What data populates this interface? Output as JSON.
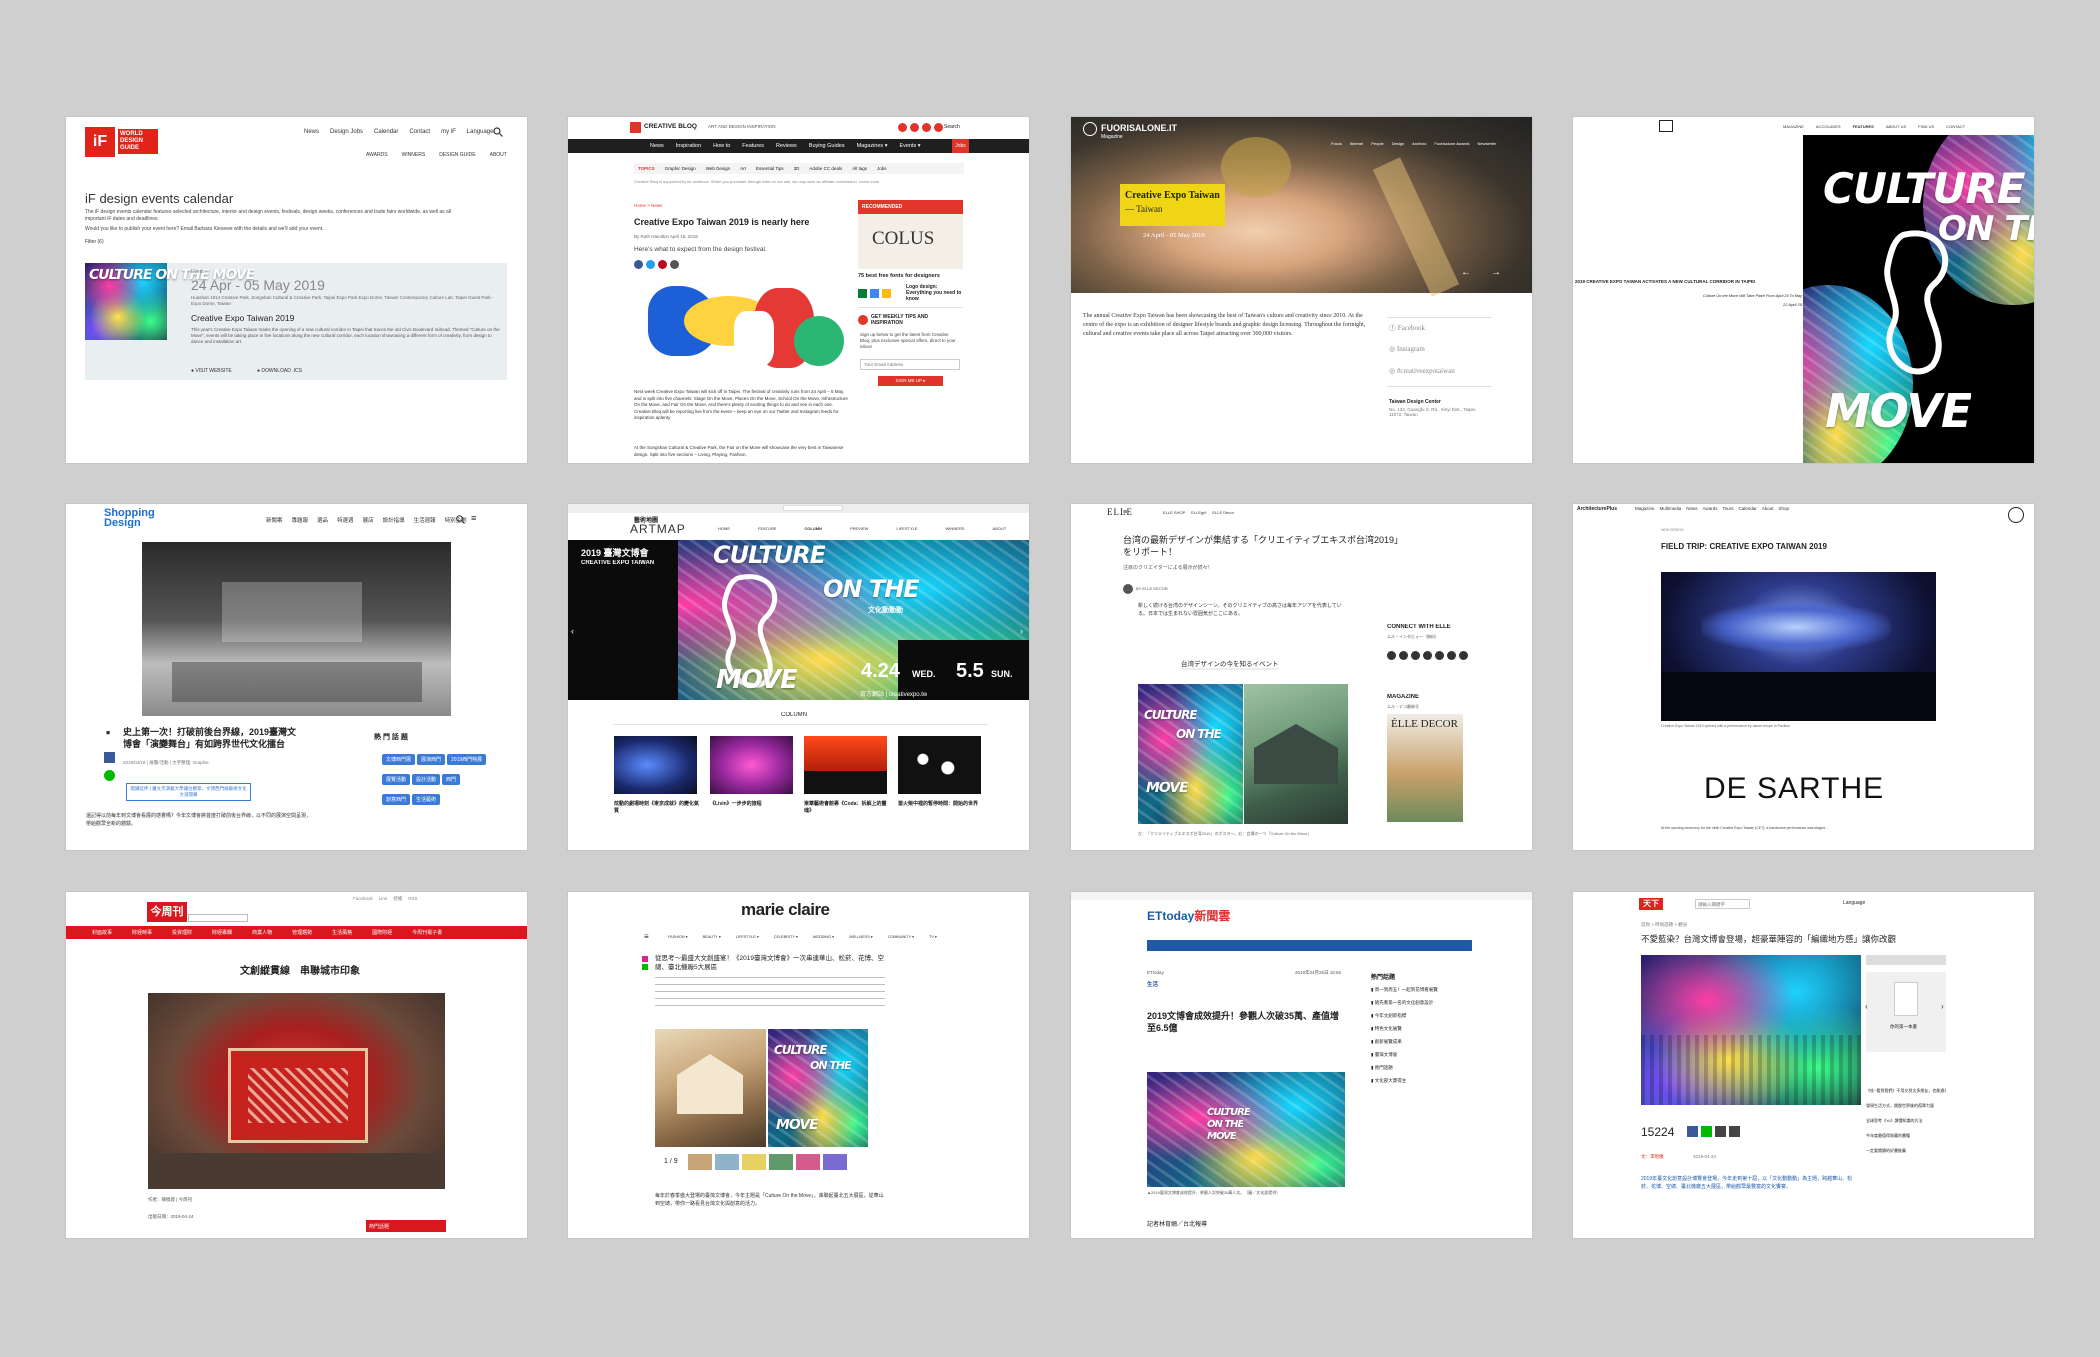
{
  "if": {
    "logo": "iF",
    "logo_sub": "WORLD DESIGN GUIDE",
    "nav": [
      "News",
      "Design Jobs",
      "Calendar",
      "Contact",
      "my iF",
      "Language"
    ],
    "subnav": [
      "AWARDS",
      "WINNERS",
      "DESIGN GUIDE",
      "ABOUT"
    ],
    "title": "iF design events calendar",
    "intro": "The iF design events calendar features selected architecture, interior and design events, festivals, design weeks, conferences and trade fairs worldwide, as well as all important iF dates and deadlines.",
    "intro2": "Would you like to publish your event here? Email Barbara Kiesewe with the details and we'll add your event.",
    "filter": "Filter (6)",
    "event_label": "Event",
    "date": "24 Apr - 05 May 2019",
    "location": "Huashan 1914 Creative Park, Songshan Cultural & Creative Park, Taipei Expo Park Expo Dome, Taiwan Contemporary Culture Lab, Taipei Guest Park - Expo Dome, Taiwan",
    "event_title": "Creative Expo Taiwan 2019",
    "desc": "This year's Creative Expo Taiwan marks the opening of a new cultural corridor in Taipei that traces the old Civic Boulevard railroad. Themed \"Culture on the Move\", events will be taking place in five locations along the new cultural corridor, each location showcasing a different form of creativity, from design to dance and installation art.",
    "visit": "VISIT WEBSITE",
    "download": "DOWNLOAD .ICS",
    "poster_text": "CULTURE ON THE MOVE"
  },
  "cb": {
    "logo": "CREATIVE BLOQ",
    "tagline": "ART AND DESIGN INSPIRATION",
    "search": "Search",
    "nav": [
      "News",
      "Inspiration",
      "How to",
      "Features",
      "Reviews",
      "Buying Guides",
      "Magazines ▾",
      "Events ▾"
    ],
    "jobs": "Jobs",
    "topics_label": "TOPICS",
    "topics": [
      "Graphic Design",
      "Web Design",
      "Art",
      "Essential Tips",
      "3D",
      "Adobe CC deals",
      "All tags",
      "Jobs"
    ],
    "disclaimer": "Creative Bloq is supported by its audience. When you purchase through links on our site, we may earn an affiliate commission. Learn more",
    "breadcrumb": "Home > News",
    "headline": "Creative Expo Taiwan 2019 is nearly here",
    "byline": "By Ruth Hamilton  April 15, 2019",
    "standfirst": "Here's what to expect from the design festival.",
    "recommended": "RECOMMENDED",
    "ad_brand": "COLUS",
    "ad_cap": "75 best free fonts for designers",
    "logo_design": "Logo design: Everything you need to know",
    "tips": "GET WEEKLY TIPS AND INSPIRATION",
    "signup": "Sign up below to get the latest from Creative Bloq, plus exclusive special offers, direct to your inbox!",
    "email_ph": "Your Email Address",
    "signup_btn": "SIGN ME UP ▸",
    "body1": "Next week Creative Expo Taiwan will kick off in Taipei. The festival of creativity runs from 24 April – 5 May, and is split into five channels: Stage On the Move, Places On the Move, School On the Move, Infrastructure On the Move, and Fair On the Move. And there's plenty of exciting things to do and see in each one. Creative Bloq will be reporting live from the event – keep an eye on our Twitter and Instagram feeds for inspiration aplenty.",
    "body2": "At the Songshan Cultural & Creative Park, the Fair on the Move will showcase the very best in Taiwanese design. Split into five sections – Living, Playing, Fashion,"
  },
  "fs": {
    "logo": "FUORISALONE.IT",
    "sub": "Magazine",
    "nav": [
      "Focus",
      "Itinerari",
      "People",
      "Design",
      "Archivio",
      "Fuorisalone Awards",
      "Newsletter"
    ],
    "hero_title": "Creative Expo Taiwan",
    "hero_sub": "— Taiwan",
    "hero_date": "24 April - 05 May 2019",
    "body": "The annual Creative Expo Taiwan has been showcasing the best of Taiwan's culture and creativity since 2010. At the centre of the expo is an exhibition of designer lifestyle brands and graphic design licensing. Throughout the fortnight, cultural and creative events take place all across Taipei attracting over 300,000 visitors.",
    "social": [
      "Facebook",
      "Instagram",
      "#creativeexpotaiwan"
    ],
    "org": "Taiwan Design Center",
    "addr": "No. 133, Guangfu S. Rd., Xinyi Dist., Taipei, 11072, Taiwan"
  },
  "af": {
    "nav": [
      "MAGAZINE",
      "ACCOLADES",
      "FEATURES",
      "ABOUT US",
      "FIND US",
      "CONTACT"
    ],
    "headline": "2019 CREATIVE EXPO TAIWAN ACTIVATES A NEW CULTURAL CORRIDOR IN TAIPEI",
    "caption": "Culture On the Move Will Take Place From April 24 To May 5",
    "date": "22 April 2019",
    "poster_top": "CULTURE",
    "poster_mid": "ON THE",
    "poster_bot": "MOVE"
  },
  "sd": {
    "logo_top": "Shopping",
    "logo_bot": "Design",
    "nav": [
      "新聞案",
      "專題報",
      "選品",
      "特選週",
      "展店",
      "設計指導",
      "生活週報",
      "特別企劃"
    ],
    "title": "史上第一次！打破前後台界線，2019臺灣文博會「演變舞台」有如跨界世代文化擂台",
    "meta": "2019/04/18 | 展覽/活動 | 文字整理: Graphie",
    "hot": "熱 門 話 題",
    "tags": [
      "文博西門展",
      "展演西門",
      "2019西門特展",
      "展覽活動",
      "設計活動",
      "西門",
      "創意西門",
      "生活藝術"
    ],
    "link_box": "閱讀延伸 | 蕭文杰演藝大學讓位觀眾，文博西門展藝術文化大道開幕",
    "body": "還記得以前每年到文博會看展的感覺嗎？今年文博會將首度打破前後台界線，以不同的展演空間呈現，帶給觀眾全新的體驗。"
  },
  "am": {
    "logo_cn": "藝術地圖",
    "logo": "ARTMAP",
    "nav": [
      "HOME",
      "FEATURE",
      "COLUMN",
      "PREVIEW",
      "LIFESTYLE",
      "WINNERS",
      "ABOUT"
    ],
    "banner_title": "2019 臺灣文博會",
    "banner_en": "CREATIVE EXPO TAIWAN",
    "cotm1": "CULTURE",
    "cotm2": "ON THE",
    "cotm3": "MOVE",
    "cn_sub": "文化動動動",
    "dates": "4.24",
    "wed": "WED.",
    "dates2": "5.5",
    "sun": "SUN.",
    "site": "官方網站 | creativexpo.tw",
    "section": "COLUMN",
    "thumbs": [
      "炫動的劇場時刻《東京成就》的變化氣質",
      "《Livin》一步步的旅程",
      "東華藝術會館專《Coda：拆解上的靈魂》",
      "當火柴中裡的暫停時間：開始的世界"
    ]
  },
  "elle": {
    "logo": "ELLE",
    "nav": [
      "ELLE SHOP",
      "ELLEgirl",
      "ELLE Décor"
    ],
    "title": "台湾の最新デザインが集結する「クリエイティブエキスポ台湾2019」をリポート！",
    "subtitle": "注目のクリエイターによる展示が続々！",
    "byline": "BY ELLE DECOR",
    "body": "新しく続ける台湾のデザインシーン。そのクリエイティブの高さは毎年アジアを代表している。日本では生まれない雰囲気がここにある。",
    "section": "台湾デザインの今を知るイベント",
    "connect": "CONNECT WITH ELLE",
    "connect_sub": "エル・インタビュー（無料）",
    "magazine": "MAGAZINE",
    "magazine_sub": "エル・デコ最新号",
    "decor": "ÉLLE DECOR",
    "caption": "左：「クリエイティブエキスポ台湾2019」のポスター。右：会場の一つ「Culture On the Move」"
  },
  "ap": {
    "logo": "ArchitecturePlus",
    "nav": [
      "Magazine",
      "Multimedia",
      "News",
      "Awards",
      "Tours",
      "Calendar",
      "About",
      "Shop"
    ],
    "kicker": "NEW DESIGN",
    "headline": "FIELD TRIP: CREATIVE EXPO TAIWAN 2019",
    "caption": "Creative Expo Taiwan 2019 opened with a performance by dance troupe in Pavilion",
    "ad": "DE SARTHE",
    "body": "At the opening ceremony for the ninth Creative Expo Taiwan (CET), a handsome performance was staged..."
  },
  "jrx": {
    "logo": "今周刊",
    "top_links": [
      "Facebook",
      "Line",
      "授權",
      "RSS"
    ],
    "nav": [
      "封面故事",
      "財經時事",
      "投資理財",
      "財經專欄",
      "商業人物",
      "管理趨勢",
      "生活風格",
      "國際財經",
      "今周刊電子書"
    ],
    "headline": "文創縱貫線　串聯城市印象",
    "meta1": "作者：陳曉蓉 | 今周刊",
    "meta2": "出版日期：2019-04-24",
    "hot": "熱門話題"
  },
  "mc": {
    "logo": "marie claire",
    "nav": [
      "FASHION ▾",
      "BEAUTY ▾",
      "LIFESTYLE ▾",
      "CELEBRITY ▾",
      "WEDDING ▾",
      "WELLNESS ▾",
      "COMMUNITY ▾",
      "TV ▾"
    ],
    "headline": "從思考～最盛大文創盛宴！《2019臺灣文博會》一次串連華山、松菸、花博、空總、臺北機廠5大展區",
    "pager": "1 / 9",
    "cotm1": "CULTURE",
    "cotm2": "ON THE",
    "cotm3": "MOVE",
    "body": "每年於春季盛大登場的臺灣文博會，今年主題是「Culture On the Move」，串聯起臺北五大展區，從華山到空總，帶你一路看見台灣文化與創意的活力。"
  },
  "et": {
    "logo": "ETtoday",
    "logo_cn": "新聞雲",
    "section": "生活",
    "date": "2019年04月25日 16:56",
    "headline": "2019文博會成效提升！參觀人次破35萬、產值增至6.5億",
    "hot": "熱門話題",
    "cotm1": "CULTURE",
    "cotm2": "ON THE",
    "cotm3": "MOVE",
    "byline": "記者林育姍／台北報導",
    "caption": "▲2019臺灣文博會成效提升，參觀人次突破35萬人次。（圖／文化部提供）",
    "sidebar": [
      "周一到周五！一起到花博看展覽",
      "搶先看第一名的文化創意設計",
      "今年文創新指標",
      "特色文化展覽",
      "創新展覽成果",
      "臺灣文博會",
      "熱門話題",
      "文化部大獎得主"
    ]
  },
  "cw": {
    "logo": "天下",
    "search_ph": "請輸入關鍵字",
    "lang": "Language",
    "breadcrumb": "首頁 > 時尚話題 > 觀光",
    "headline": "不愛藍染？台灣文博會登場，超豪華陣容的「編織地方感」讓你改觀",
    "count": "15224",
    "byline": "文：李昭儀",
    "date": "2019-04-24",
    "side_title": "你的第一本書",
    "side_list": [
      "《哇~看到我們》不用交到太多朋友，也能過得好",
      "發現生活方式，跳脫世界後的孤單力量",
      "全球思考《Yo》讀懂知識的方法",
      "今年度最值得收藏的書籍",
      "一定要閱讀的好書推薦"
    ],
    "body": "2019年臺文化創意設計博覽會登場，今年走到第十屆，以「文化動動動」為主題，跨越華山、松菸、花博、空總、臺北機廠五大展區，帶給觀眾最豐富的文化饗宴。"
  }
}
